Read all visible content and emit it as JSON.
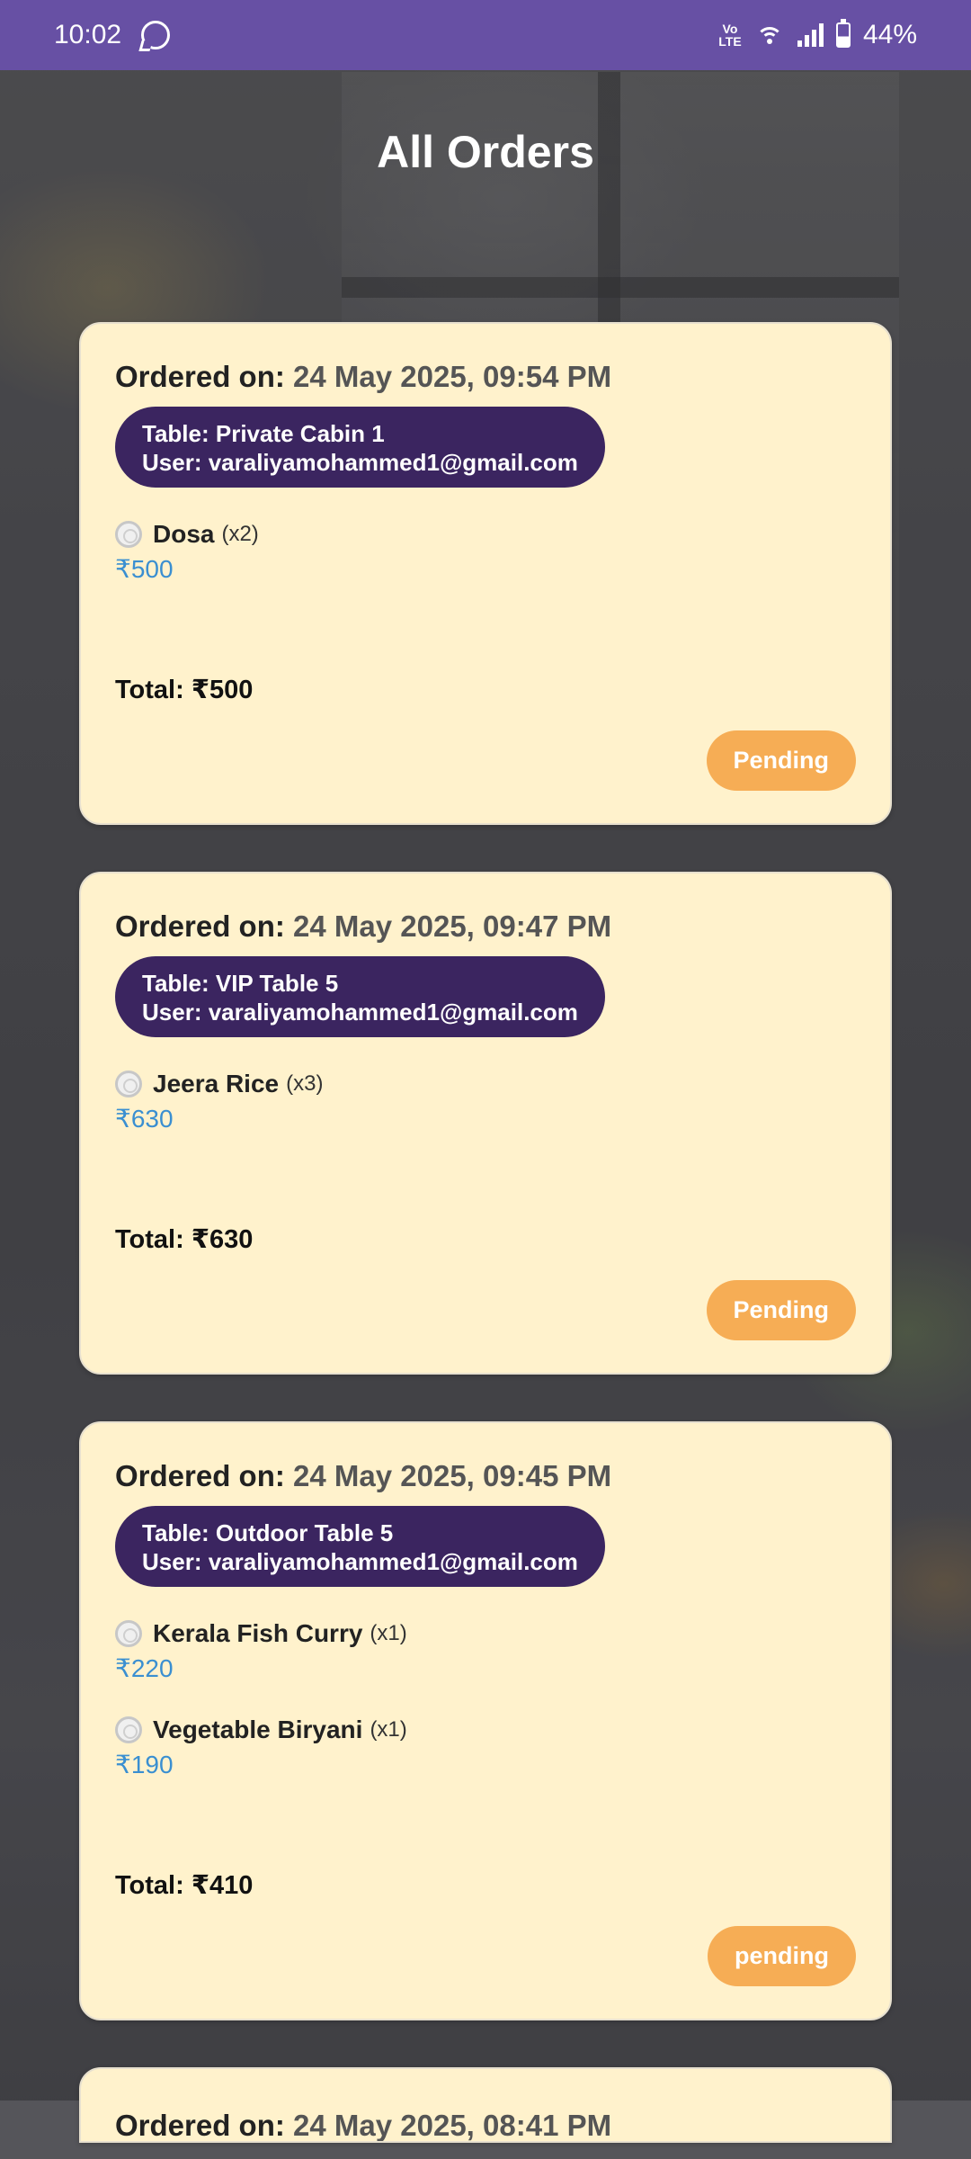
{
  "status_bar": {
    "time": "10:02",
    "network_label": "VoLTE",
    "battery": "44%",
    "app_icon": "whatsapp-icon"
  },
  "page": {
    "title": "All Orders"
  },
  "orders": [
    {
      "ordered_on_label": "Ordered on:",
      "date": "24 May 2025, 09:54 PM",
      "table_line": "Table: Private Cabin 1",
      "user_line": "User: varaliyamohammed1@gmail.com",
      "items": [
        {
          "name": "Dosa",
          "qty": "(x2)",
          "price": "₹500"
        }
      ],
      "total": "Total: ₹500",
      "status": "Pending"
    },
    {
      "ordered_on_label": "Ordered on:",
      "date": "24 May 2025, 09:47 PM",
      "table_line": "Table: VIP Table 5",
      "user_line": "User: varaliyamohammed1@gmail.com",
      "items": [
        {
          "name": "Jeera Rice",
          "qty": "(x3)",
          "price": "₹630"
        }
      ],
      "total": "Total: ₹630",
      "status": "Pending"
    },
    {
      "ordered_on_label": "Ordered on:",
      "date": "24 May 2025, 09:45 PM",
      "table_line": "Table: Outdoor Table 5",
      "user_line": "User: varaliyamohammed1@gmail.com",
      "items": [
        {
          "name": "Kerala Fish Curry",
          "qty": "(x1)",
          "price": "₹220"
        },
        {
          "name": "Vegetable Biryani",
          "qty": "(x1)",
          "price": "₹190"
        }
      ],
      "total": "Total: ₹410",
      "status": "pending"
    },
    {
      "ordered_on_label": "Ordered on:",
      "date": "24 May 2025, 08:41 PM"
    }
  ],
  "colors": {
    "status_bar": "#6750a4",
    "card": "#fff2cc",
    "pill": "#3b2560",
    "price": "#3a8fd1",
    "badge": "#f6ad55"
  }
}
